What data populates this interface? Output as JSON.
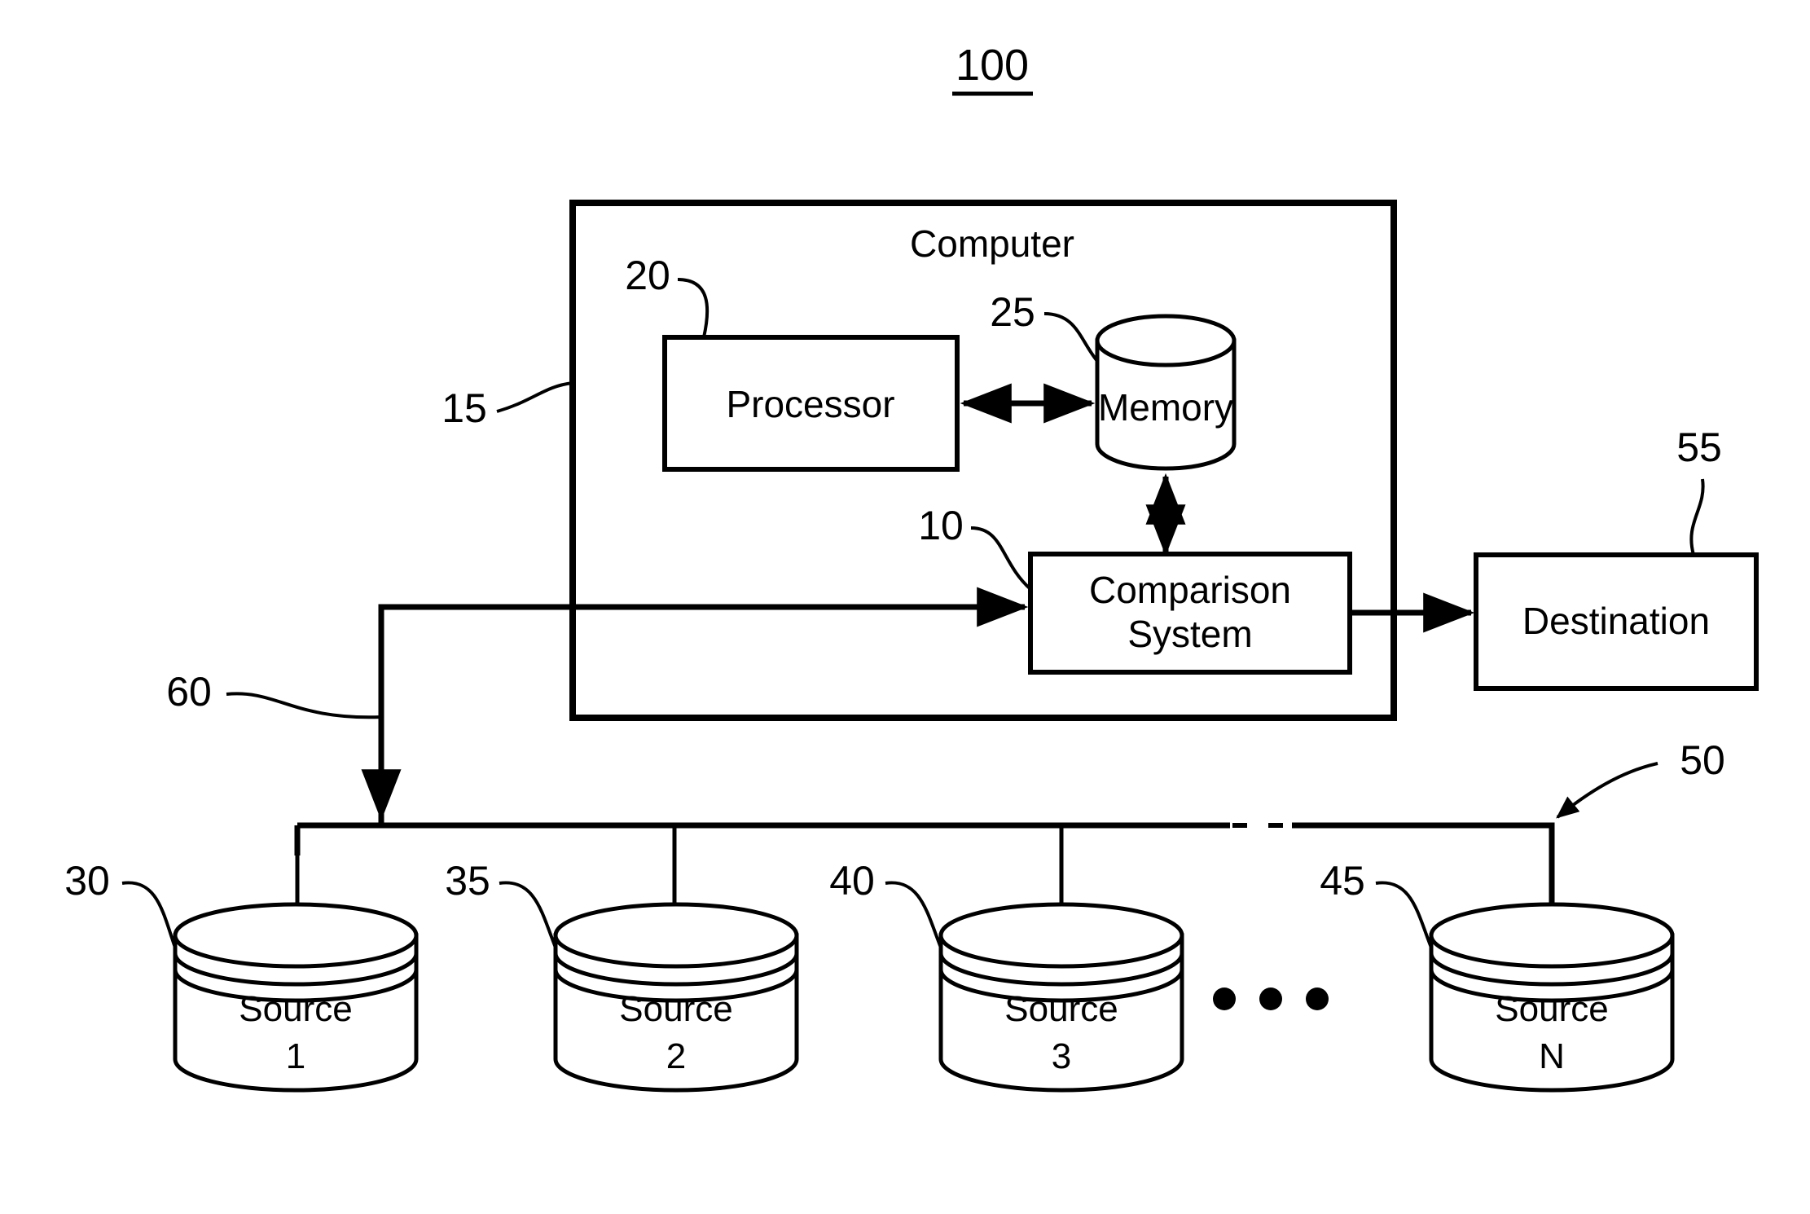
{
  "figure": {
    "title": "100",
    "type": "patent-block-diagram"
  },
  "blocks": {
    "computer": {
      "label": "Computer",
      "ref": "15"
    },
    "processor": {
      "label": "Processor",
      "ref": "20"
    },
    "memory": {
      "label": "Memory",
      "ref": "25"
    },
    "comparison_system": {
      "label_line1": "Comparison",
      "label_line2": "System",
      "ref": "10"
    },
    "destination": {
      "label": "Destination",
      "ref": "55"
    }
  },
  "bus": {
    "ref": "50",
    "input_ref": "60",
    "ellipsis": "• • •"
  },
  "sources": [
    {
      "label": "Source",
      "index": "1",
      "ref": "30"
    },
    {
      "label": "Source",
      "index": "2",
      "ref": "35"
    },
    {
      "label": "Source",
      "index": "3",
      "ref": "40"
    },
    {
      "label": "Source",
      "index": "N",
      "ref": "45"
    }
  ],
  "colors": {
    "ink": "#000000",
    "paper": "#ffffff"
  }
}
